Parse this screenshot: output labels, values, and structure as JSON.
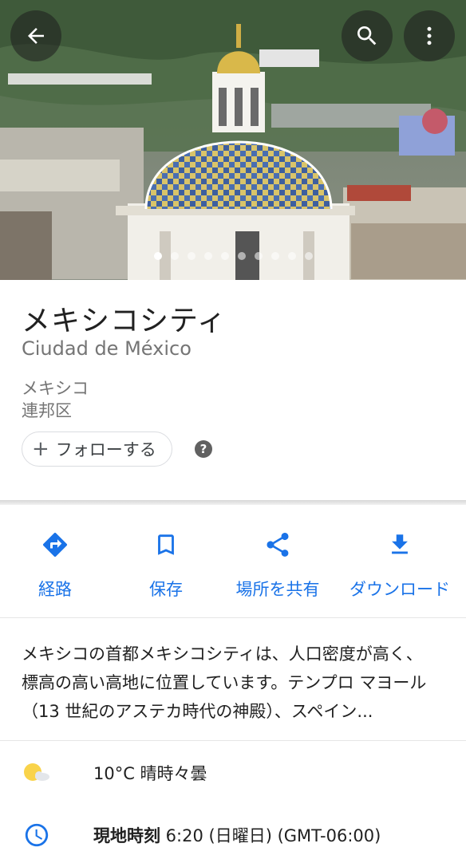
{
  "hero": {
    "photo_description_icon": "cathedral-dome-photo",
    "slide_count": 10,
    "active_slide": 1
  },
  "place": {
    "name": "メキシコシティ",
    "native_name": "Ciudad de México",
    "region_line1": "メキシコ",
    "region_line2": "連邦区",
    "follow_label": "フォローする",
    "help_glyph": "?"
  },
  "actions": [
    {
      "label": "経路",
      "icon": "directions-icon"
    },
    {
      "label": "保存",
      "icon": "bookmark-icon"
    },
    {
      "label": "場所を共有",
      "icon": "share-icon"
    },
    {
      "label": "ダウンロード",
      "icon": "download-icon"
    }
  ],
  "description": {
    "line1": "メキシコの首都メキシコシティは、人口密度が高く、",
    "line2": "標高の高い高地に位置しています。テンプロ マヨール",
    "line3": "（13 世紀のアステカ時代の神殿）、スペイン..."
  },
  "weather": {
    "text": "10°C 晴時々曇"
  },
  "local_time": {
    "label": "現地時刻",
    "value": " 6:20 (日曜日) (GMT-06:00)"
  },
  "colors": {
    "accent": "#1a73e8",
    "weather_sun": "#f9d34a"
  }
}
